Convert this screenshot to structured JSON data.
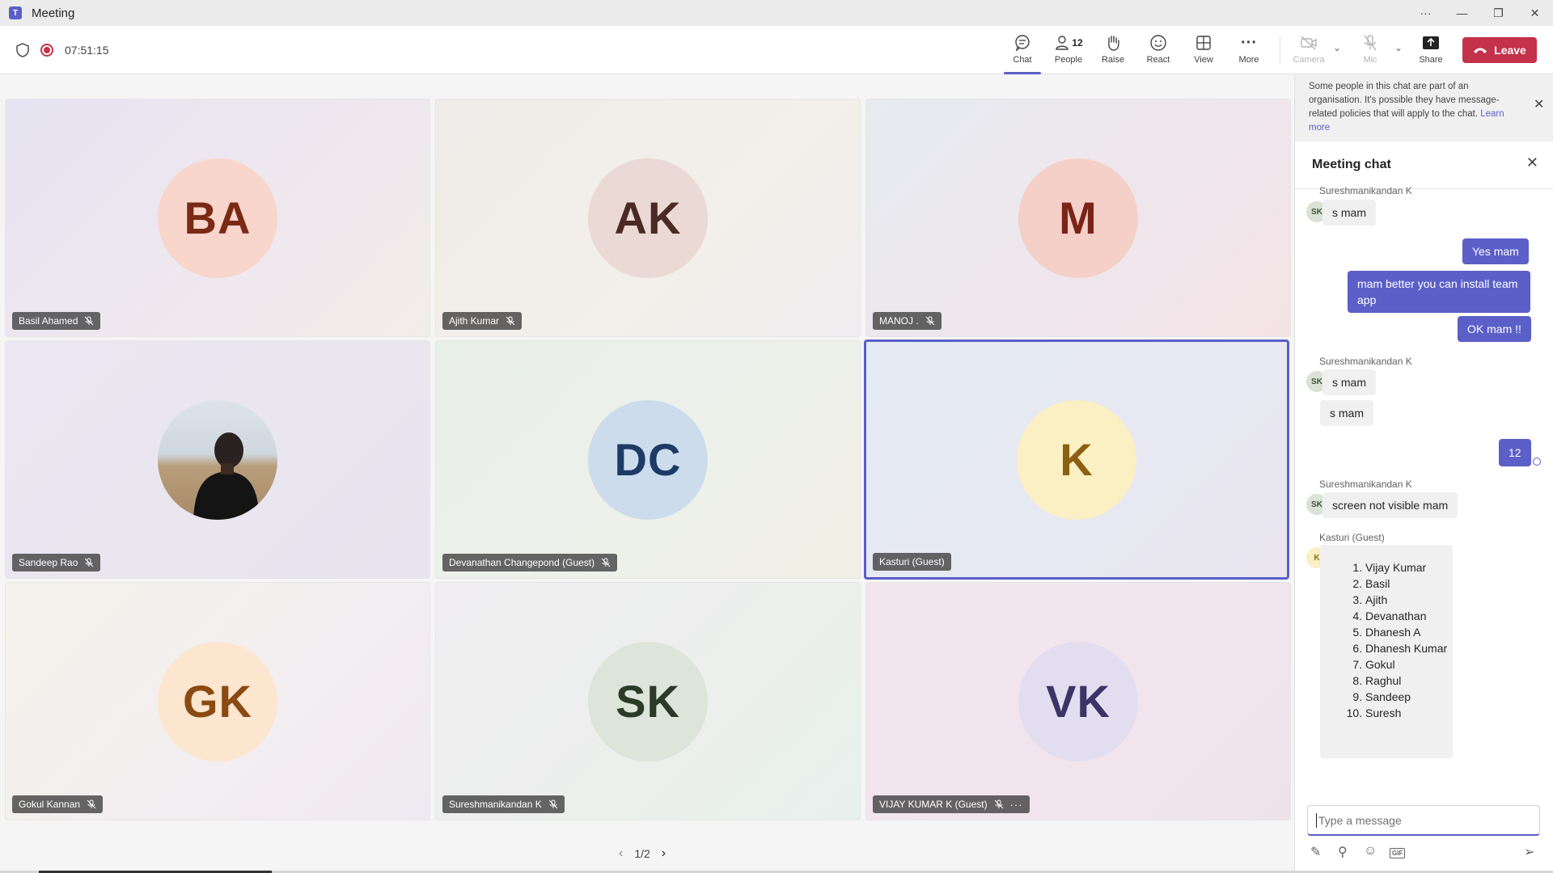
{
  "window": {
    "title": "Meeting",
    "controls": [
      "···",
      "—",
      "❐",
      "✕"
    ]
  },
  "toolbar": {
    "timer": "07:51:15",
    "buttons": {
      "chat": "Chat",
      "people": "People",
      "people_count": "12",
      "raise": "Raise",
      "react": "React",
      "view": "View",
      "more": "More",
      "camera": "Camera",
      "mic": "Mic",
      "share": "Share"
    },
    "leave": "Leave"
  },
  "tiles": [
    {
      "name": "Basil Ahamed",
      "initials": "BA",
      "bg": "#f8d6cc",
      "fg": "#7a2a14"
    },
    {
      "name": "Ajith Kumar",
      "initials": "AK",
      "bg": "#ead9d5",
      "fg": "#4a2a22"
    },
    {
      "name": "MANOJ .",
      "initials": "M",
      "bg": "#f5d0c8",
      "fg": "#7a2418"
    },
    {
      "name": "Sandeep Rao",
      "initials": "",
      "bg": "#c9b79c",
      "fg": "#000000"
    },
    {
      "name": "Devanathan Changepond (Guest)",
      "initials": "DC",
      "bg": "#ccdcec",
      "fg": "#1e3a66"
    },
    {
      "name": "Kasturi (Guest)",
      "initials": "K",
      "bg": "#fbefc4",
      "fg": "#8c6010"
    },
    {
      "name": "Gokul Kannan",
      "initials": "GK",
      "bg": "#fde6d0",
      "fg": "#8a4a12"
    },
    {
      "name": "Sureshmanikandan K",
      "initials": "SK",
      "bg": "#dde4da",
      "fg": "#2c3a28"
    },
    {
      "name": "VIJAY KUMAR K (Guest)",
      "initials": "VK",
      "bg": "#e2def0",
      "fg": "#3a3566"
    }
  ],
  "pager": {
    "label": "1/2"
  },
  "chat": {
    "notice": "Some people in this chat are part of an organisation. It's possible they have message-related policies that will apply to the chat.",
    "notice_link": "Learn more",
    "heading": "Meeting chat",
    "sender_sk": "Sureshmanikandan K",
    "sender_k": "Kasturi (Guest)",
    "avatar_sk": "SK",
    "avatar_k": "K",
    "messages": {
      "m1": "s mam",
      "m2": "Yes mam",
      "m3": "mam better you can install team app",
      "m4": "OK mam !!",
      "m5": "s mam",
      "m6": "s mam",
      "m7": "12",
      "m8": "screen not visible mam"
    },
    "list": [
      "Vijay Kumar",
      "Basil",
      "Ajith",
      "Devanathan",
      "Dhanesh A",
      "Dhanesh Kumar",
      "Gokul",
      "Raghul",
      "Sandeep",
      "Suresh"
    ],
    "compose_placeholder": "Type a message"
  },
  "colors": {
    "accent": "#5b5fc7",
    "leave": "#c4314b"
  }
}
